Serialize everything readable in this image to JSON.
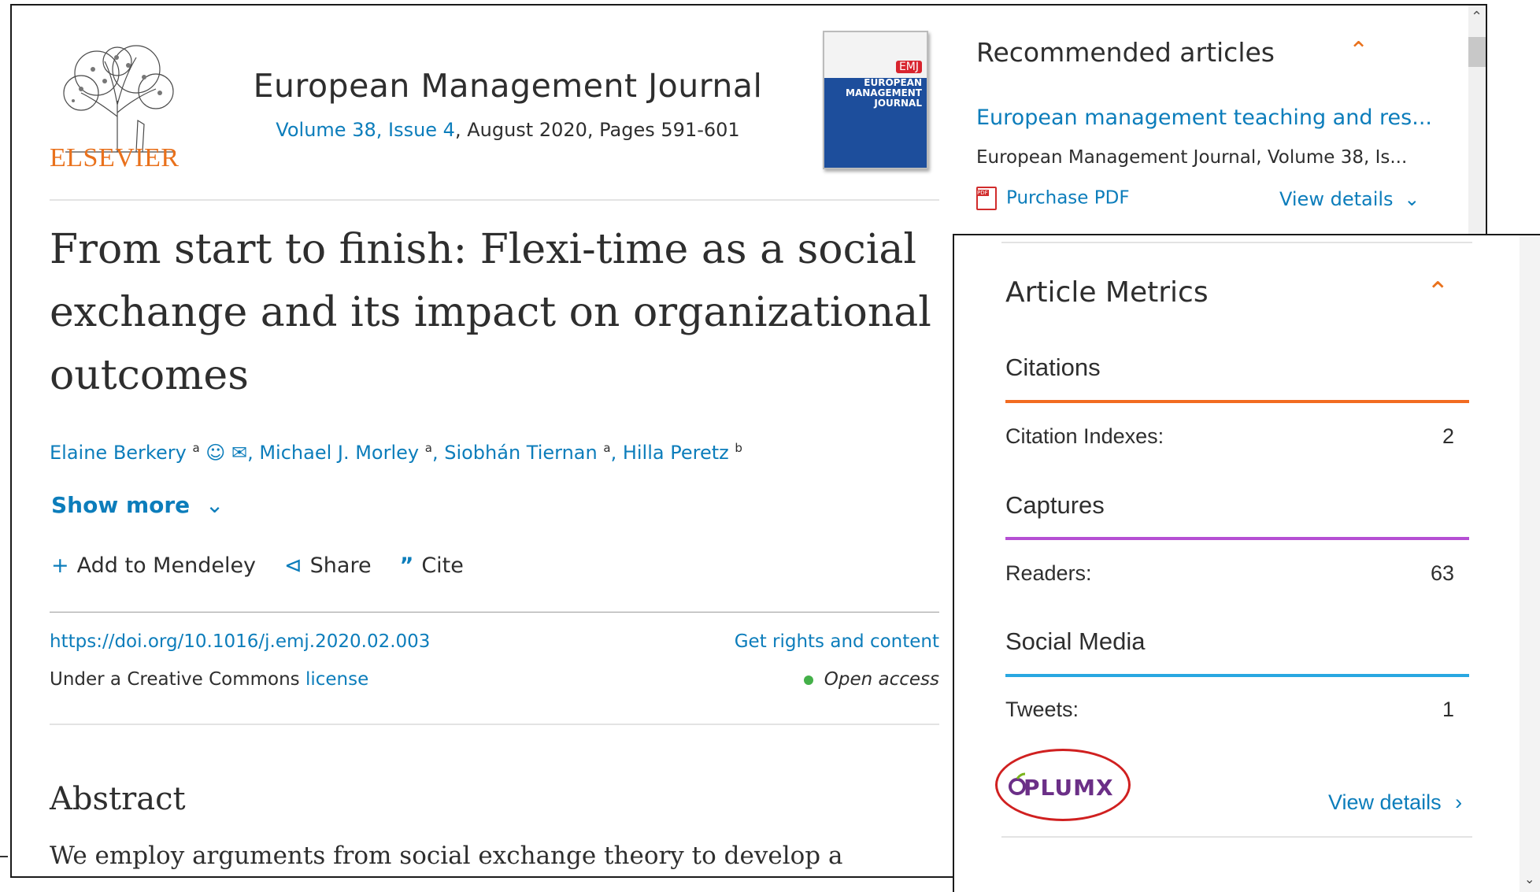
{
  "header": {
    "publisher": "ELSEVIER",
    "journal_title": "European Management Journal",
    "issue_link": "Volume 38, Issue 4",
    "issue_rest": ", August 2020, Pages 591-601",
    "cover_badge": "EMJ",
    "cover_caption": "EUROPEAN MANAGEMENT JOURNAL"
  },
  "article": {
    "title": "From start to finish: Flexi-time as a social exchange and its impact on organizational outcomes",
    "authors": [
      {
        "name": "Elaine Berkery",
        "sup": "a"
      },
      {
        "name": "Michael J. Morley",
        "sup": "a"
      },
      {
        "name": "Siobhán Tiernan",
        "sup": "a"
      },
      {
        "name": "Hilla Peretz",
        "sup": "b"
      }
    ],
    "show_more": "Show more",
    "actions": {
      "mendeley": "Add to Mendeley",
      "share": "Share",
      "cite": "Cite"
    },
    "doi": "https://doi.org/10.1016/j.emj.2020.02.003",
    "rights": "Get rights and content",
    "license_prefix": "Under a Creative Commons ",
    "license_link": "license",
    "open_access": "Open access",
    "abstract_heading": "Abstract",
    "abstract_text": "We employ arguments from social exchange theory to develop a"
  },
  "recommended": {
    "heading": "Recommended articles",
    "item_title": "European management teaching and res...",
    "item_source": "European Management Journal, Volume 38, Is...",
    "purchase": "Purchase PDF",
    "view_details": "View details"
  },
  "metrics": {
    "heading": "Article Metrics",
    "sections": [
      {
        "name": "Citations",
        "label": "Citation Indexes:",
        "value": "2",
        "color": "#f26b21"
      },
      {
        "name": "Captures",
        "label": "Readers:",
        "value": "63",
        "color": "#b54fd3"
      },
      {
        "name": "Social Media",
        "label": "Tweets:",
        "value": "1",
        "color": "#29a7e1"
      }
    ],
    "plumx_logo": "PLUMX",
    "view_details": "View details"
  },
  "icons": {
    "collapse": "chevron-up-icon",
    "expand": "chevron-down-icon",
    "person": "person-icon",
    "email": "envelope-icon",
    "plus": "plus-icon",
    "share": "share-icon",
    "cite": "quote-icon",
    "pdf": "pdf-icon"
  }
}
